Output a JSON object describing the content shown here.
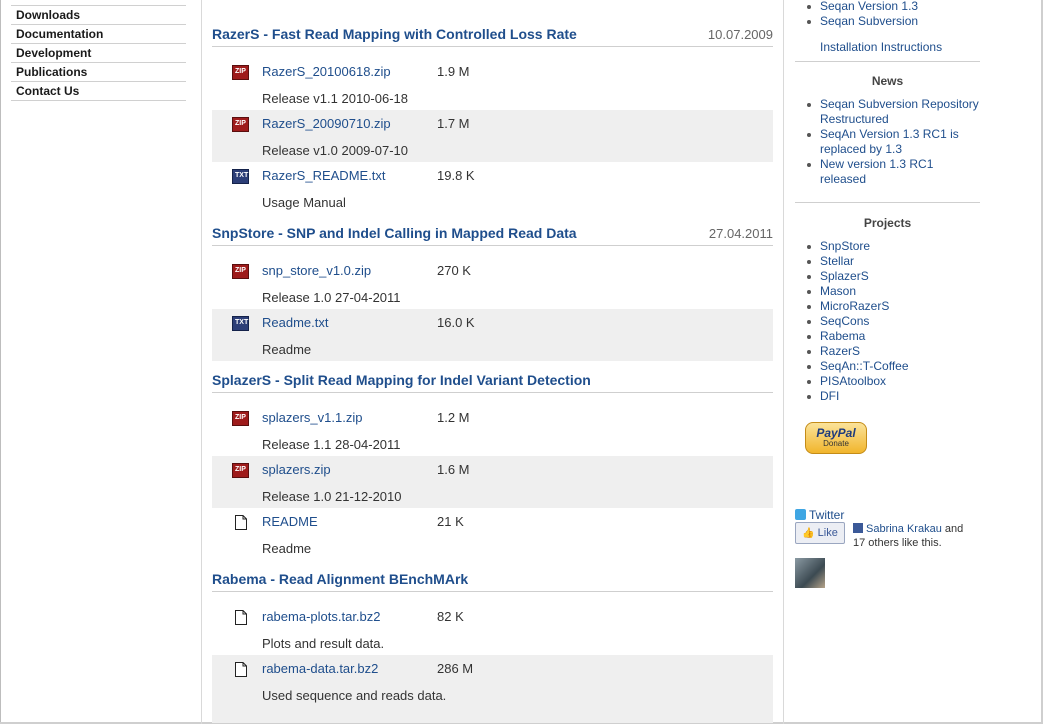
{
  "leftnav": {
    "items": [
      "Downloads",
      "Documentation",
      "Development",
      "Publications",
      "Contact Us"
    ]
  },
  "main": {
    "sections": [
      {
        "title": "RazerS - Fast Read Mapping with Controlled Loss Rate",
        "date": "10.07.2009",
        "files": [
          {
            "name": "RazerS_20100618.zip",
            "size": "1.9 M",
            "desc": "Release v1.1 2010-06-18",
            "icon": "zip-file-icon"
          },
          {
            "name": "RazerS_20090710.zip",
            "size": "1.7 M",
            "desc": "Release v1.0 2009-07-10",
            "icon": "zip-file-icon"
          },
          {
            "name": "RazerS_README.txt",
            "size": "19.8 K",
            "desc": "Usage Manual",
            "icon": "txt-file-icon"
          }
        ]
      },
      {
        "title": "SnpStore - SNP and Indel Calling in Mapped Read Data",
        "date": "27.04.2011",
        "files": [
          {
            "name": "snp_store_v1.0.zip",
            "size": "270 K",
            "desc": "Release 1.0 27-04-2011",
            "icon": "zip-file-icon"
          },
          {
            "name": "Readme.txt",
            "size": "16.0 K",
            "desc": "Readme",
            "icon": "txt-file-icon"
          }
        ]
      },
      {
        "title": "SplazerS - Split Read Mapping for Indel Variant Detection",
        "date": "",
        "files": [
          {
            "name": "splazers_v1.1.zip",
            "size": "1.2 M",
            "desc": "Release 1.1 28-04-2011",
            "icon": "zip-file-icon"
          },
          {
            "name": "splazers.zip",
            "size": "1.6 M",
            "desc": "Release 1.0 21-12-2010",
            "icon": "zip-file-icon"
          },
          {
            "name": "README",
            "size": "21 K",
            "desc": "Readme",
            "icon": "document-icon"
          }
        ]
      },
      {
        "title": "Rabema - Read Alignment BEnchMArk",
        "date": "",
        "files": [
          {
            "name": "rabema-plots.tar.bz2",
            "size": "82 K",
            "desc": "Plots and result data.",
            "icon": "document-icon"
          },
          {
            "name": "rabema-data.tar.bz2",
            "size": "286 M",
            "desc": "Used sequence and reads data.",
            "icon": "document-icon"
          }
        ]
      }
    ]
  },
  "sidebar": {
    "top_links": [
      "Seqan Version 1.3",
      "Seqan Subversion"
    ],
    "install_link": "Installation Instructions",
    "news_title": "News",
    "news": [
      "Seqan Subversion Repository Restructured",
      "SeqAn Version 1.3 RC1 is replaced by 1.3",
      "New version 1.3 RC1 released"
    ],
    "projects_title": "Projects",
    "projects": [
      "SnpStore",
      "Stellar",
      "SplazerS",
      "Mason",
      "MicroRazerS",
      "SeqCons",
      "Rabema",
      "RazerS",
      "SeqAn::T-Coffee",
      "PISAtoolbox",
      "DFI"
    ],
    "paypal_logo": "PayPal",
    "paypal_label": "Donate",
    "twitter_label": "Twitter",
    "like_label": "Like",
    "fb_name": "Sabrina Krakau",
    "fb_text": " and 17 others like this."
  },
  "colors": {
    "link": "#1f4e8c",
    "row_alt": "#efefef",
    "zip_icon": "#9e1b1b",
    "txt_icon": "#2c3e77"
  }
}
